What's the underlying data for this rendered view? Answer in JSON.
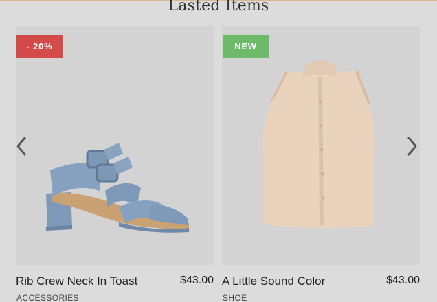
{
  "section": {
    "title": "Lasted Items"
  },
  "products": [
    {
      "badge": "- 20%",
      "badge_color": "#d44a48",
      "name": "Rib Crew Neck In Toast",
      "price": "$43.00",
      "category": "ACCESSORIES",
      "image_icon": "blue-sandal-icon"
    },
    {
      "badge": "NEW",
      "badge_color": "#6dba68",
      "name": "A Little Sound Color",
      "price": "$43.00",
      "category": "SHOE",
      "image_icon": "beige-sleeveless-shirt-icon"
    }
  ],
  "nav": {
    "prev_icon": "chevron-left-icon",
    "next_icon": "chevron-right-icon"
  },
  "colors": {
    "accent_rule": "#d9b98f",
    "background": "#dcdcdc"
  }
}
